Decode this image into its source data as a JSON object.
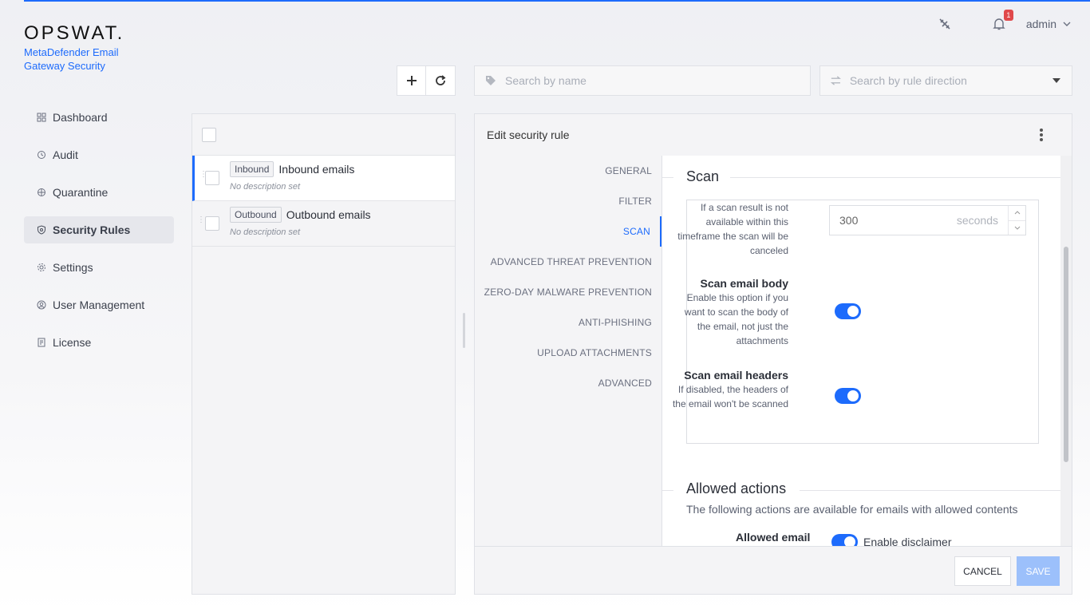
{
  "app": {
    "logo": "OPSWAT.",
    "product_name": "MetaDefender Email Gateway Security",
    "user": "admin",
    "notifications_count": "1",
    "accent_color": "#1d6bfc"
  },
  "sidebar": {
    "items": [
      {
        "label": "Dashboard",
        "icon": "dashboard-icon"
      },
      {
        "label": "Audit",
        "icon": "audit-icon"
      },
      {
        "label": "Quarantine",
        "icon": "quarantine-icon"
      },
      {
        "label": "Security Rules",
        "icon": "shield-icon",
        "active": true
      },
      {
        "label": "Settings",
        "icon": "gear-icon"
      },
      {
        "label": "User Management",
        "icon": "user-icon"
      },
      {
        "label": "License",
        "icon": "license-icon"
      }
    ]
  },
  "search": {
    "name_placeholder": "Search by name",
    "direction_placeholder": "Search by rule direction"
  },
  "rules": [
    {
      "tag": "Inbound",
      "name": "Inbound emails",
      "description": "No description set",
      "selected": true
    },
    {
      "tag": "Outbound",
      "name": "Outbound emails",
      "description": "No description set",
      "selected": false
    }
  ],
  "editor": {
    "title": "Edit security rule",
    "tabs": [
      "GENERAL",
      "FILTER",
      "SCAN",
      "ADVANCED THREAT PREVENTION",
      "ZERO-DAY MALWARE PREVENTION",
      "ANTI-PHISHING",
      "UPLOAD ATTACHMENTS",
      "ADVANCED"
    ],
    "active_tab": "SCAN",
    "scan": {
      "section_title": "Scan",
      "timeout_desc": "If a scan result is not available within this timeframe the scan will be canceled",
      "timeout_value": "300",
      "timeout_unit": "seconds",
      "body_label": "Scan email body",
      "body_desc": "Enable this option if you want to scan the body of the email, not just the attachments",
      "body_enabled": true,
      "headers_label": "Scan email headers",
      "headers_desc": "If disabled, the headers of the email won't be scanned",
      "headers_enabled": true
    },
    "allowed": {
      "section_title": "Allowed actions",
      "description": "The following actions are available for emails with allowed contents",
      "email_label": "Allowed email",
      "disclaimer_label": "Enable disclaimer",
      "disclaimer_enabled": true
    },
    "buttons": {
      "cancel": "CANCEL",
      "save": "SAVE"
    }
  }
}
